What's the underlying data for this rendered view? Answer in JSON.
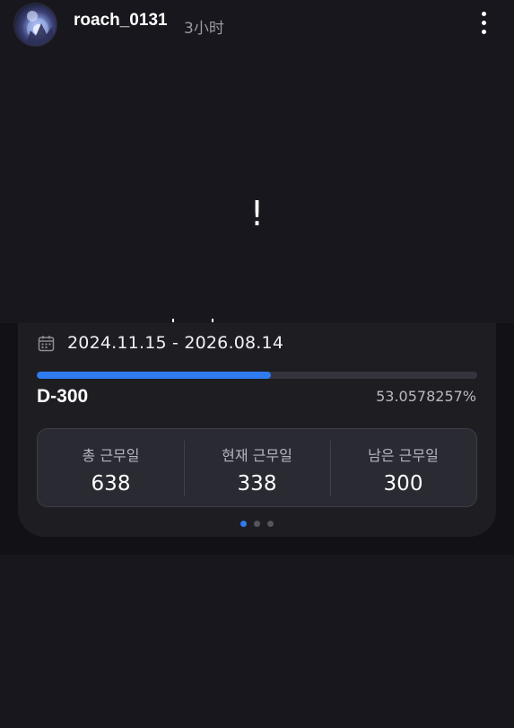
{
  "header": {
    "username": "roach_0131",
    "time_ago": "3小时",
    "avatar_icon": "user-avatar",
    "more_icon": "more-vertical-icon"
  },
  "media": {
    "text": "!"
  },
  "widget": {
    "calendar_icon": "calendar-icon",
    "date_range": "2024.11.15 - 2026.08.14",
    "progress_fraction": 0.530578257,
    "d_day": "D-300",
    "percent_text": "53.0578257%",
    "stats": [
      {
        "label": "총 근무일",
        "value": "638"
      },
      {
        "label": "현재 근무일",
        "value": "338"
      },
      {
        "label": "남은 근무일",
        "value": "300"
      }
    ],
    "pager": {
      "count": 3,
      "active_index": 0
    },
    "colors": {
      "accent": "#2f7bf0",
      "track": "#34343c",
      "inactive_dot": "#55555e"
    }
  }
}
